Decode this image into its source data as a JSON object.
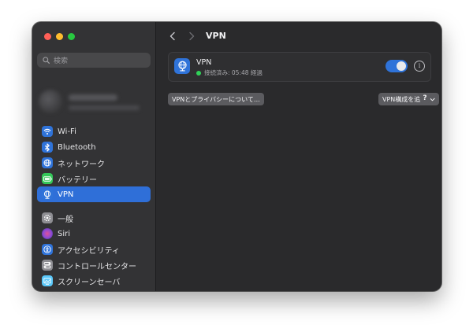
{
  "window": {
    "title": "VPN"
  },
  "sidebar": {
    "search_placeholder": "検索",
    "items": [
      {
        "label": "Wi-Fi",
        "icon": "wifi-icon",
        "color": "#2f73d9",
        "selected": false
      },
      {
        "label": "Bluetooth",
        "icon": "bluetooth-icon",
        "color": "#2f73d9",
        "selected": false
      },
      {
        "label": "ネットワーク",
        "icon": "globe-icon",
        "color": "#2f73d9",
        "selected": false
      },
      {
        "label": "バッテリー",
        "icon": "battery-icon",
        "color": "#34c759",
        "selected": false
      },
      {
        "label": "VPN",
        "icon": "vpn-globe-icon",
        "color": "#2f73d9",
        "selected": true
      },
      {
        "label": "一般",
        "icon": "gear-icon",
        "color": "#8e8e93",
        "selected": false
      },
      {
        "label": "Siri",
        "icon": "siri-icon",
        "color": "#8a4bd6",
        "selected": false
      },
      {
        "label": "アクセシビリティ",
        "icon": "accessibility-icon",
        "color": "#2f73d9",
        "selected": false
      },
      {
        "label": "コントロールセンター",
        "icon": "control-center-icon",
        "color": "#8e8e93",
        "selected": false
      },
      {
        "label": "スクリーンセーバ",
        "icon": "screensaver-icon",
        "color": "#5ac8fa",
        "selected": false
      }
    ]
  },
  "main": {
    "vpn": {
      "name": "VPN",
      "status": "接続済み: 05:48 経過",
      "enabled": true
    },
    "privacy_button": "VPNとプライバシーについて…",
    "add_config_button": "VPN構成を追加",
    "help_label": "?"
  },
  "colors": {
    "accent": "#2f73d9",
    "connected": "#30d158"
  }
}
